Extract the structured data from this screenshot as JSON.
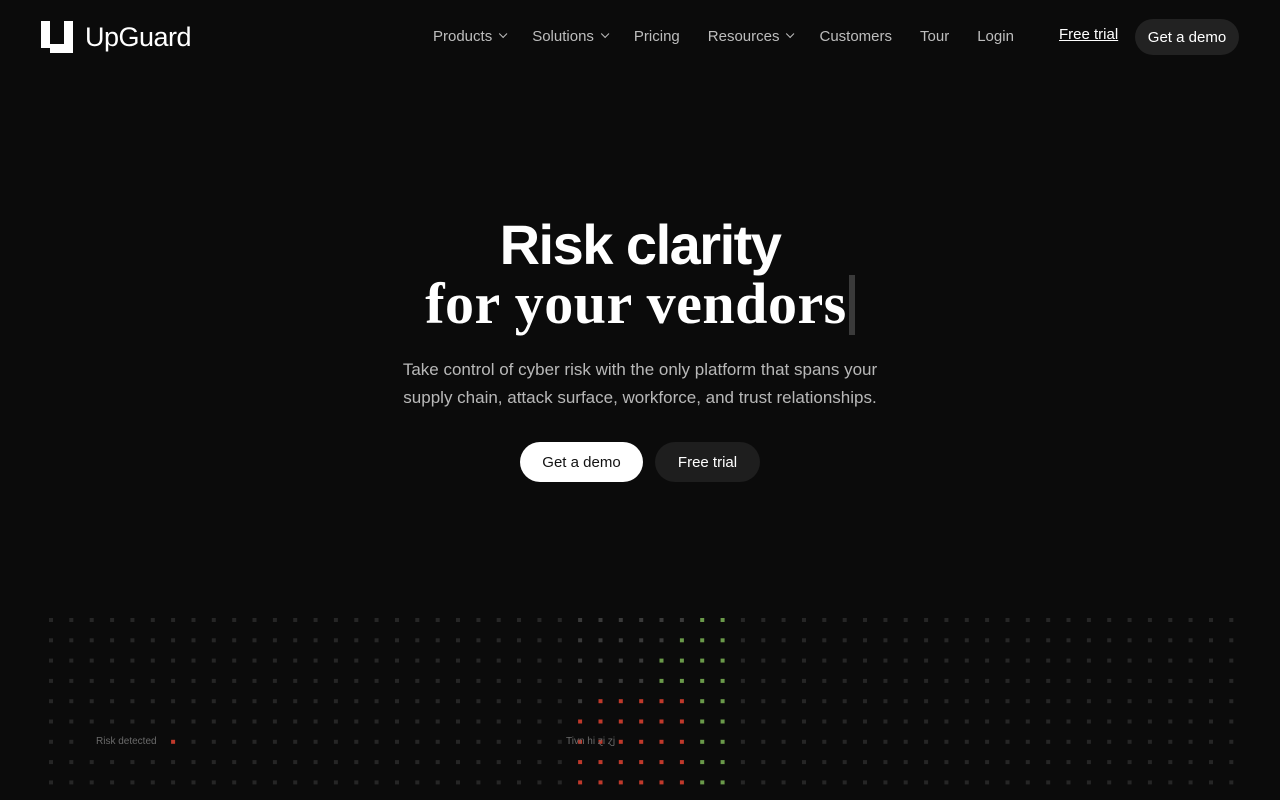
{
  "brand": {
    "name": "UpGuard"
  },
  "nav": {
    "items": [
      {
        "label": "Products",
        "dropdown": true
      },
      {
        "label": "Solutions",
        "dropdown": true
      },
      {
        "label": "Pricing",
        "dropdown": false
      },
      {
        "label": "Resources",
        "dropdown": true
      },
      {
        "label": "Customers",
        "dropdown": false
      },
      {
        "label": "Tour",
        "dropdown": false
      },
      {
        "label": "Login",
        "dropdown": false
      }
    ],
    "free_trial": "Free trial",
    "get_demo": "Get a demo"
  },
  "hero": {
    "title_line1": "Risk clarity",
    "title_line2": "for your vendors",
    "subtitle_line1": "Take control of cyber risk with the only platform that spans your",
    "subtitle_line2": "supply chain, attack surface, workforce, and trust relationships.",
    "cta_primary": "Get a demo",
    "cta_secondary": "Free trial"
  },
  "visualization": {
    "risk_label": "Risk detected",
    "center_label": "Tivn hi ɀi ɀj",
    "colors": {
      "dim": "#262626",
      "red": "#c0392b",
      "green": "#6a9a4a",
      "mid": "#3a3a3a"
    }
  }
}
